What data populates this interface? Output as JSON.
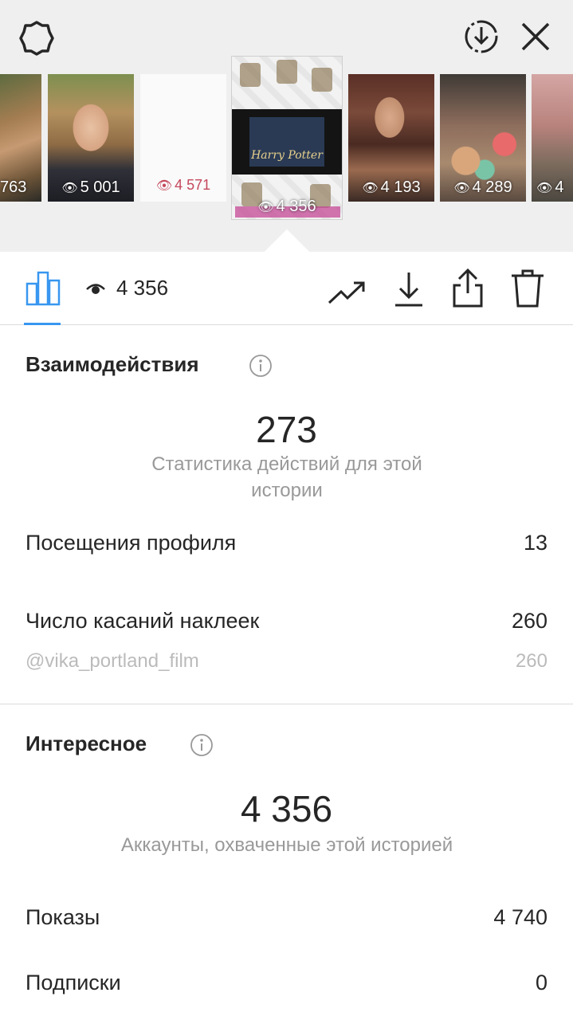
{
  "viewer": {
    "thumbnails": [
      {
        "name": "thumb-1",
        "views": "763"
      },
      {
        "name": "thumb-2",
        "views": "5 001"
      },
      {
        "name": "thumb-3",
        "views": "4 571"
      },
      {
        "name": "thumb-4",
        "views": "4 356",
        "image_text": "Harry Potter",
        "tag": "@vika_portland_film"
      },
      {
        "name": "thumb-5",
        "views": "4 193"
      },
      {
        "name": "thumb-6",
        "views": "4 289"
      },
      {
        "name": "thumb-7",
        "views": "4"
      }
    ]
  },
  "toolbar": {
    "views": "4 356",
    "tabs": [
      "insights",
      "promote",
      "download",
      "share",
      "delete"
    ]
  },
  "icons": {
    "gear": "gear-icon",
    "download_circle": "download-circle-icon",
    "close": "close-icon",
    "bars": "bar-chart-icon",
    "eye": "eye-icon",
    "trend": "trend-icon",
    "download": "download-icon",
    "share": "share-icon",
    "trash": "trash-icon",
    "info": "info-icon"
  },
  "colors": {
    "accent": "#3897f0",
    "text": "#262626",
    "muted": "#999999",
    "divider": "#dbdbdb"
  },
  "interactions": {
    "title": "Взаимодействия",
    "total": "273",
    "caption": "Статистика действий для этой истории",
    "rows": [
      {
        "label": "Посещения профиля",
        "value": "13"
      },
      {
        "label": "Число касаний наклеек",
        "value": "260"
      },
      {
        "label": "@vika_portland_film",
        "value": "260"
      }
    ]
  },
  "discovery": {
    "title": "Интересное",
    "total": "4 356",
    "caption": "Аккаунты, охваченные этой историей",
    "rows": [
      {
        "label": "Показы",
        "value": "4 740"
      },
      {
        "label": "Подписки",
        "value": "0"
      }
    ]
  }
}
